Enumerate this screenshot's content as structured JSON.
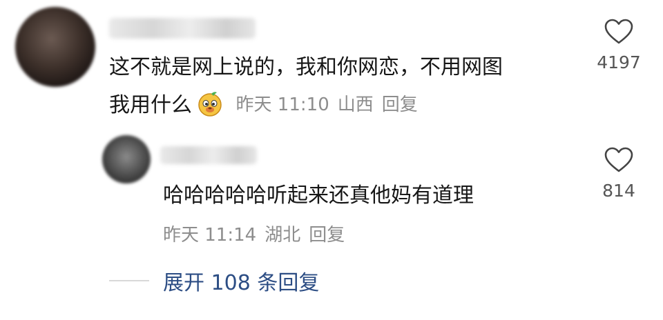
{
  "comment": {
    "text_line1": "这不就是网上说的，我和你网恋，不用网图",
    "text_line2": "我用什么",
    "emoji": "doge-emoji",
    "time": "昨天 11:10",
    "location": "山西",
    "reply_label": "回复",
    "like_count": "4197"
  },
  "reply": {
    "text": "哈哈哈哈哈听起来还真他妈有道理",
    "time": "昨天 11:14",
    "location": "湖北",
    "reply_label": "回复",
    "like_count": "814"
  },
  "expand": {
    "label": "展开 108 条回复"
  },
  "colors": {
    "link": "#2c4d84",
    "meta": "#8d8d8d"
  }
}
